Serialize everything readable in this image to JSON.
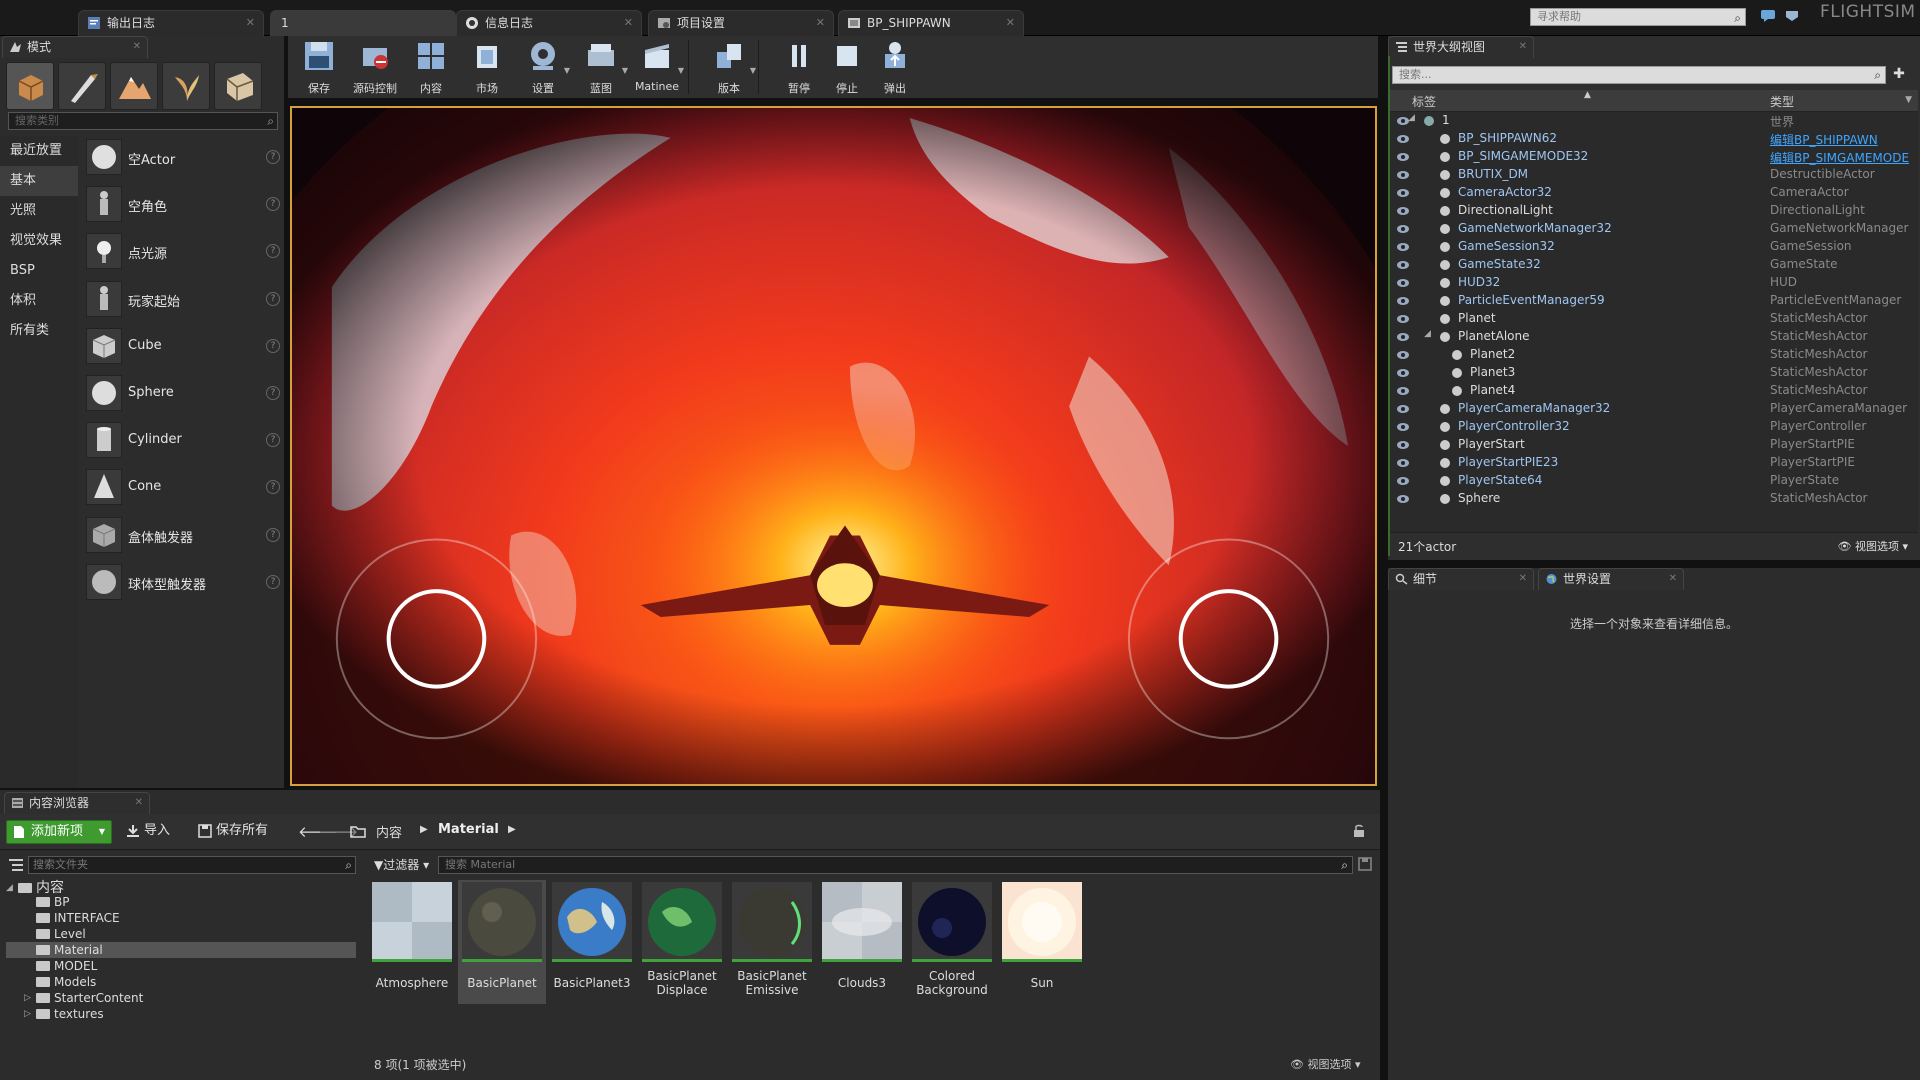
{
  "title_tabs": [
    {
      "label": "输出日志",
      "icon": "output-log-icon"
    },
    {
      "label": "1",
      "icon": "level-icon"
    },
    {
      "label": "信息日志",
      "icon": "message-log-icon"
    },
    {
      "label": "项目设置",
      "icon": "project-settings-icon"
    },
    {
      "label": "BP_SHIPPAWN",
      "icon": "blueprint-icon"
    }
  ],
  "help_search": {
    "placeholder": "寻求帮助"
  },
  "brand": "FLIGHTSIM",
  "modes": {
    "tab_label": "模式",
    "search_placeholder": "搜索类别",
    "categories": [
      "最近放置",
      "基本",
      "光照",
      "视觉效果",
      "BSP",
      "体积",
      "所有类"
    ],
    "active_category": 1,
    "items": [
      "空Actor",
      "空角色",
      "点光源",
      "玩家起始",
      "Cube",
      "Sphere",
      "Cylinder",
      "Cone",
      "盒体触发器",
      "球体型触发器"
    ],
    "help_glyph": "?"
  },
  "toolbar": {
    "buttons": [
      "保存",
      "源码控制",
      "内容",
      "市场",
      "设置",
      "蓝图",
      "Matinee",
      "版本",
      "暂停",
      "停止",
      "弹出"
    ]
  },
  "outliner": {
    "tab_label": "世界大纲视图",
    "search_placeholder": "搜索...",
    "col_label": "标签",
    "col_type": "类型",
    "rows": [
      {
        "name": "1",
        "type": "世界",
        "link": false
      },
      {
        "name": "BP_SHIPPAWN62",
        "type": "编辑BP_SHIPPAWN",
        "link": true
      },
      {
        "name": "BP_SIMGAMEMODE32",
        "type": "编辑BP_SIMGAMEMODE",
        "link": true
      },
      {
        "name": "BRUTIX_DM",
        "type": "DestructibleActor",
        "link": false
      },
      {
        "name": "CameraActor32",
        "type": "CameraActor",
        "link": false
      },
      {
        "name": "DirectionalLight",
        "type": "DirectionalLight",
        "link": false
      },
      {
        "name": "GameNetworkManager32",
        "type": "GameNetworkManager",
        "link": false
      },
      {
        "name": "GameSession32",
        "type": "GameSession",
        "link": false
      },
      {
        "name": "GameState32",
        "type": "GameState",
        "link": false
      },
      {
        "name": "HUD32",
        "type": "HUD",
        "link": false
      },
      {
        "name": "ParticleEventManager59",
        "type": "ParticleEventManager",
        "link": false
      },
      {
        "name": "Planet",
        "type": "StaticMeshActor",
        "link": false
      },
      {
        "name": "PlanetAlone",
        "type": "StaticMeshActor",
        "link": false
      },
      {
        "name": "Planet2",
        "type": "StaticMeshActor",
        "link": false
      },
      {
        "name": "Planet3",
        "type": "StaticMeshActor",
        "link": false
      },
      {
        "name": "Planet4",
        "type": "StaticMeshActor",
        "link": false
      },
      {
        "name": "PlayerCameraManager32",
        "type": "PlayerCameraManager",
        "link": false
      },
      {
        "name": "PlayerController32",
        "type": "PlayerController",
        "link": false
      },
      {
        "name": "PlayerStart",
        "type": "PlayerStartPIE",
        "link": false
      },
      {
        "name": "PlayerStartPIE23",
        "type": "PlayerStartPIE",
        "link": false
      },
      {
        "name": "PlayerState64",
        "type": "PlayerState",
        "link": false
      },
      {
        "name": "Sphere",
        "type": "StaticMeshActor",
        "link": false
      }
    ],
    "actor_count": "21个actor",
    "view_options": "视图选项"
  },
  "details": {
    "tabs": [
      "细节",
      "世界设置"
    ],
    "empty_message": "选择一个对象来查看详细信息。"
  },
  "content_browser": {
    "tab_label": "内容浏览器",
    "add_new": "添加新项",
    "import": "导入",
    "save_all": "保存所有",
    "breadcrumb": [
      "内容",
      "Material"
    ],
    "folder_search_placeholder": "搜索文件夹",
    "filters_label": "过滤器",
    "asset_search_placeholder": "搜索 Material",
    "tree": [
      {
        "label": "内容",
        "level": 0,
        "root": true
      },
      {
        "label": "BP",
        "level": 1
      },
      {
        "label": "INTERFACE",
        "level": 1
      },
      {
        "label": "Level",
        "level": 1
      },
      {
        "label": "Material",
        "level": 1,
        "selected": true
      },
      {
        "label": "MODEL",
        "level": 1
      },
      {
        "label": "Models",
        "level": 1
      },
      {
        "label": "StarterContent",
        "level": 1,
        "expandable": true
      },
      {
        "label": "textures",
        "level": 1,
        "expandable": true
      }
    ],
    "assets": [
      {
        "name": "Atmosphere",
        "kind": "checker"
      },
      {
        "name": "BasicPlanet",
        "kind": "rock",
        "selected": true
      },
      {
        "name": "BasicPlanet3",
        "kind": "earth"
      },
      {
        "name": "BasicPlanet Displace",
        "kind": "green"
      },
      {
        "name": "BasicPlanet Emissive",
        "kind": "rockgreen"
      },
      {
        "name": "Clouds3",
        "kind": "cloud"
      },
      {
        "name": "Colored Background",
        "kind": "dark"
      },
      {
        "name": "Sun",
        "kind": "sun"
      }
    ],
    "status": "8 项(1 项被选中)",
    "view_options": "视图选项"
  },
  "colors": {
    "accent_green": "#3f9b2f",
    "viewport_border": "#d4a13c",
    "link_blue": "#3fa6ff",
    "actor_blue": "#9fc6f2"
  }
}
